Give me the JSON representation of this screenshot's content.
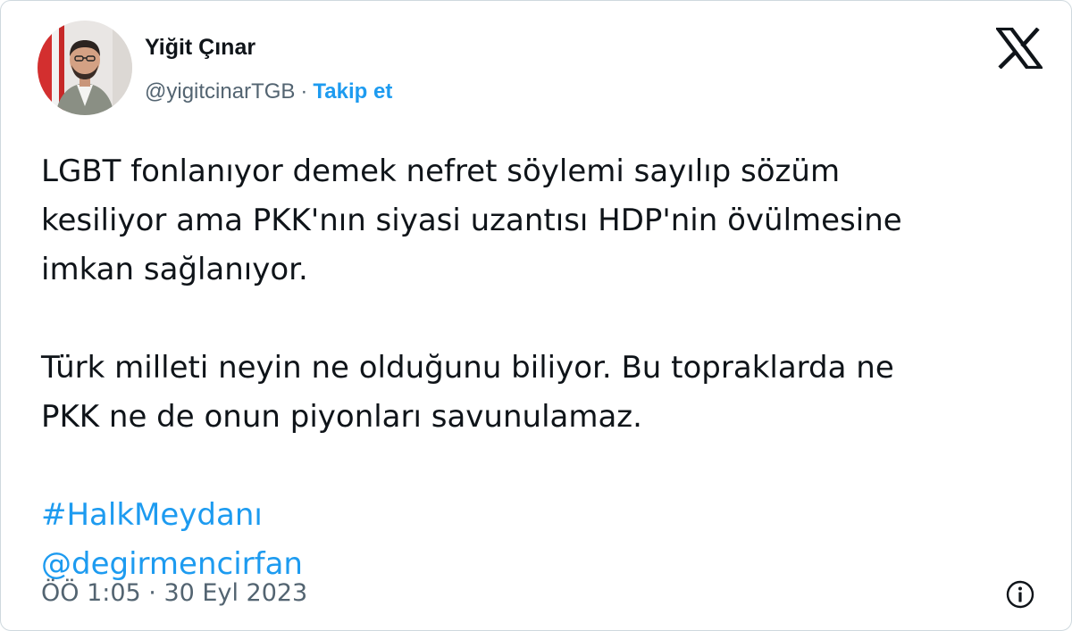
{
  "author": {
    "name": "Yiğit Çınar",
    "handle": "@yigitcinarTGB",
    "separator": "·",
    "follow_label": "Takip et",
    "avatar_icon": "profile-photo"
  },
  "brand": {
    "logo_icon": "x-logo-icon"
  },
  "tweet": {
    "paragraph_1": "LGBT fonlanıyor demek nefret söylemi sayılıp sözüm\nkesiliyor ama PKK'nın siyasi uzantısı HDP'nin övülmesine\nimkan sağlanıyor.",
    "paragraph_2": "Türk milleti neyin ne olduğunu biliyor. Bu topraklarda ne\nPKK ne de onun piyonları savunulamaz.",
    "hashtag": "#HalkMeydanı",
    "mention": "@degirmencirfan"
  },
  "footer": {
    "timestamp": "ÖÖ 1:05 · 30 Eyl 2023",
    "info_icon": "info-icon"
  },
  "colors": {
    "accent": "#1d9bf0",
    "text": "#0f1419",
    "muted": "#536471",
    "border": "#cfd9de"
  }
}
